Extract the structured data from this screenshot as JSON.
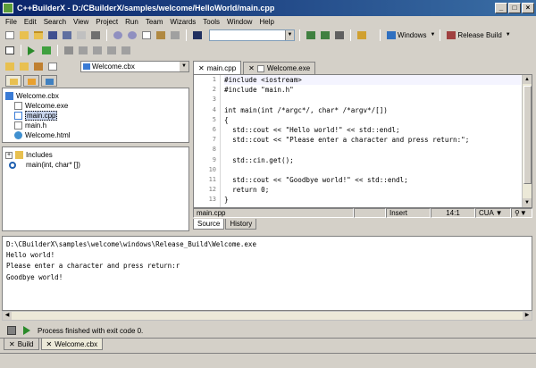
{
  "window": {
    "title": "C++BuilderX - D:/CBuilderX/samples/welcome/HelloWorld/main.cpp"
  },
  "menu": [
    "File",
    "Edit",
    "Search",
    "View",
    "Project",
    "Run",
    "Team",
    "Wizards",
    "Tools",
    "Window",
    "Help"
  ],
  "toolbar": {
    "search_value": "",
    "platform_label": "Windows",
    "build_config_label": "Release Build"
  },
  "project": {
    "combo_value": "Welcome.cbx",
    "tree": [
      {
        "label": "Welcome.cbx",
        "icon": "project-icon",
        "indent": 0
      },
      {
        "label": "Welcome.exe",
        "icon": "exe-file-icon",
        "indent": 1
      },
      {
        "label": "main.cpp",
        "icon": "cpp-file-icon",
        "indent": 1,
        "selected": true
      },
      {
        "label": "main.h",
        "icon": "header-file-icon",
        "indent": 1
      },
      {
        "label": "Welcome.html",
        "icon": "html-file-icon",
        "indent": 1
      }
    ]
  },
  "structure": {
    "includes_label": "Includes",
    "function_label": "main(int, char* [])"
  },
  "editor": {
    "tabs": [
      {
        "label": "main.cpp",
        "active": true
      },
      {
        "label": "Welcome.exe",
        "active": false
      }
    ],
    "line_numbers": [
      "1",
      "2",
      "3",
      "4",
      "5",
      "6",
      "7",
      "8",
      "9",
      "10",
      "11",
      "12",
      "13"
    ],
    "lines": [
      "#include <iostream>",
      "#include \"main.h\"",
      "",
      "int main(int /*argc*/, char* /*argv*/[])",
      "{",
      "  std::cout << \"Hello world!\" << std::endl;",
      "  std::cout << \"Please enter a character and press return:\";",
      "",
      "  std::cin.get();",
      "",
      "  std::cout << \"Goodbye world!\" << std::endl;",
      "  return 0;",
      "}"
    ],
    "status": {
      "file": "main.cpp",
      "mode": "Insert",
      "position": "14:1",
      "keymap": "CUA"
    },
    "bottom_tabs": [
      "Source",
      "History"
    ]
  },
  "output": {
    "lines": [
      "D:\\CBuilderX\\samples\\welcome\\windows\\Release_Build\\Welcome.exe",
      "Hello world!",
      "Please enter a character and press return:r",
      "Goodbye world!"
    ],
    "process_message": "Process finished with exit code 0."
  },
  "bottom_tabs": [
    {
      "label": "Build",
      "active": false
    },
    {
      "label": "Welcome.cbx",
      "active": true
    }
  ]
}
